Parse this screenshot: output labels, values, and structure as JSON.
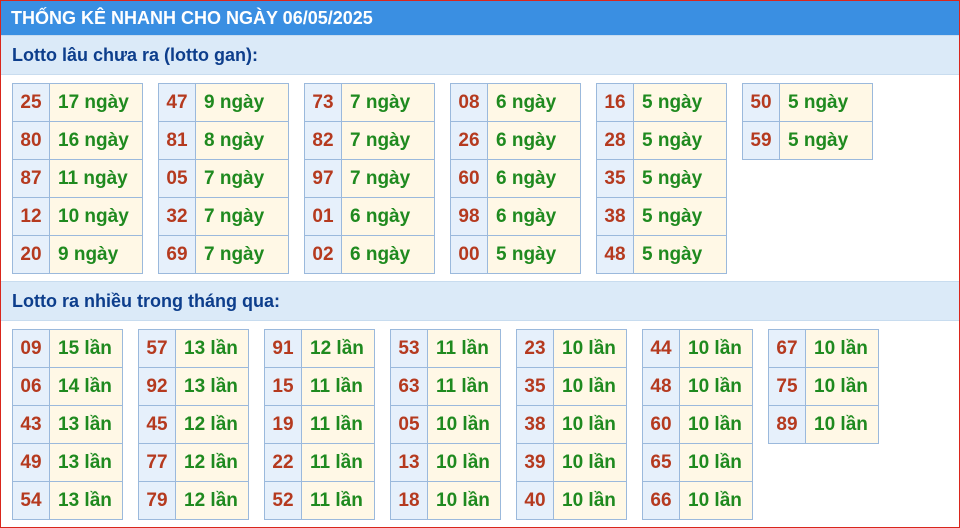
{
  "header": {
    "title": "THỐNG KÊ NHANH CHO NGÀY 06/05/2025"
  },
  "sections": [
    {
      "title": "Lotto lâu chưa ra (lotto gan):",
      "groups": [
        [
          [
            "25",
            "17 ngày"
          ],
          [
            "80",
            "16 ngày"
          ],
          [
            "87",
            "11 ngày"
          ],
          [
            "12",
            "10 ngày"
          ],
          [
            "20",
            "9 ngày"
          ]
        ],
        [
          [
            "47",
            "9 ngày"
          ],
          [
            "81",
            "8 ngày"
          ],
          [
            "05",
            "7 ngày"
          ],
          [
            "32",
            "7 ngày"
          ],
          [
            "69",
            "7 ngày"
          ]
        ],
        [
          [
            "73",
            "7 ngày"
          ],
          [
            "82",
            "7 ngày"
          ],
          [
            "97",
            "7 ngày"
          ],
          [
            "01",
            "6 ngày"
          ],
          [
            "02",
            "6 ngày"
          ]
        ],
        [
          [
            "08",
            "6 ngày"
          ],
          [
            "26",
            "6 ngày"
          ],
          [
            "60",
            "6 ngày"
          ],
          [
            "98",
            "6 ngày"
          ],
          [
            "00",
            "5 ngày"
          ]
        ],
        [
          [
            "16",
            "5 ngày"
          ],
          [
            "28",
            "5 ngày"
          ],
          [
            "35",
            "5 ngày"
          ],
          [
            "38",
            "5 ngày"
          ],
          [
            "48",
            "5 ngày"
          ]
        ],
        [
          [
            "50",
            "5 ngày"
          ],
          [
            "59",
            "5 ngày"
          ]
        ]
      ]
    },
    {
      "title": "Lotto ra nhiều trong tháng qua:",
      "groups": [
        [
          [
            "09",
            "15 lần"
          ],
          [
            "06",
            "14 lần"
          ],
          [
            "43",
            "13 lần"
          ],
          [
            "49",
            "13 lần"
          ],
          [
            "54",
            "13 lần"
          ]
        ],
        [
          [
            "57",
            "13 lần"
          ],
          [
            "92",
            "13 lần"
          ],
          [
            "45",
            "12 lần"
          ],
          [
            "77",
            "12 lần"
          ],
          [
            "79",
            "12 lần"
          ]
        ],
        [
          [
            "91",
            "12 lần"
          ],
          [
            "15",
            "11 lần"
          ],
          [
            "19",
            "11 lần"
          ],
          [
            "22",
            "11 lần"
          ],
          [
            "52",
            "11 lần"
          ]
        ],
        [
          [
            "53",
            "11 lần"
          ],
          [
            "63",
            "11 lần"
          ],
          [
            "05",
            "10 lần"
          ],
          [
            "13",
            "10 lần"
          ],
          [
            "18",
            "10 lần"
          ]
        ],
        [
          [
            "23",
            "10 lần"
          ],
          [
            "35",
            "10 lần"
          ],
          [
            "38",
            "10 lần"
          ],
          [
            "39",
            "10 lần"
          ],
          [
            "40",
            "10 lần"
          ]
        ],
        [
          [
            "44",
            "10 lần"
          ],
          [
            "48",
            "10 lần"
          ],
          [
            "60",
            "10 lần"
          ],
          [
            "65",
            "10 lần"
          ],
          [
            "66",
            "10 lần"
          ]
        ],
        [
          [
            "67",
            "10 lần"
          ],
          [
            "75",
            "10 lần"
          ],
          [
            "89",
            "10 lần"
          ]
        ]
      ]
    }
  ]
}
